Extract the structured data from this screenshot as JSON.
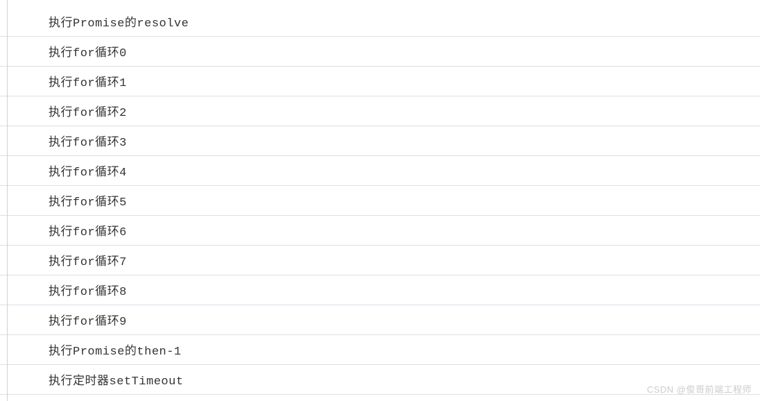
{
  "console": {
    "lines": [
      "执行Promise的resolve",
      "执行for循环0",
      "执行for循环1",
      "执行for循环2",
      "执行for循环3",
      "执行for循环4",
      "执行for循环5",
      "执行for循环6",
      "执行for循环7",
      "执行for循环8",
      "执行for循环9",
      "执行Promise的then-1",
      "执行定时器setTimeout"
    ]
  },
  "watermark": "CSDN @俊哥前端工程师"
}
